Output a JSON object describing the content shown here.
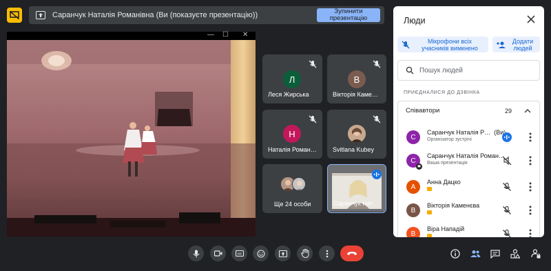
{
  "presentation": {
    "banner_text": "Саранчук Наталія Романівна (Ви (показуєте презентацію))",
    "stop_label": "Зупинити презентацію"
  },
  "tiles": [
    {
      "name": "Леся Жирська",
      "initial": "Л",
      "avatar_color": "#0b5e3a"
    },
    {
      "name": "Вікторія Каме…",
      "initial": "В",
      "avatar_color": "#7a5c4f"
    },
    {
      "name": "Наталія Роман…",
      "initial": "Н",
      "avatar_color": "#c2185b"
    },
    {
      "name": "Svitlana Kubey",
      "initial": "",
      "avatar_color": "#8d6e63"
    },
    {
      "name": "Ще 24 особи"
    },
    {
      "name": "Саранчук Нат…"
    }
  ],
  "people_panel": {
    "title": "Люди",
    "mute_all_label": "Мікрофони всіх учасників вимкнено",
    "add_people_label": "Додати людей",
    "search_placeholder": "Пошук людей",
    "section_label": "ПРИЄДНАЛИСЯ ДО ДЗВІНКА",
    "group_name": "Співавтори",
    "group_count": "29",
    "participants": [
      {
        "initial": "С",
        "color": "#8e24aa",
        "name": "Саранчук Наталія Р…",
        "suffix": "(Ви)",
        "sub": "Організатор зустрічі",
        "mic": "speaking"
      },
      {
        "initial": "С",
        "color": "#8e24aa",
        "name": "Саранчук Наталія Роман…",
        "suffix": "",
        "sub": "Ваша презентація",
        "mic": "muted-present"
      },
      {
        "initial": "А",
        "color": "#e65100",
        "name": "Анна Дацко",
        "suffix": "",
        "sub": "",
        "mic": "muted"
      },
      {
        "initial": "В",
        "color": "#795548",
        "name": "Вікторія Каменєва",
        "suffix": "",
        "sub": "",
        "mic": "muted"
      },
      {
        "initial": "В",
        "color": "#f4511e",
        "name": "Віра Нападій",
        "suffix": "",
        "sub": "",
        "mic": "muted"
      }
    ]
  },
  "colors": {
    "background": "#202124",
    "tile": "#3c4043",
    "accent_blue": "#8ab4f8",
    "end_call": "#ea4335",
    "logo_yellow": "#fbbc04"
  }
}
